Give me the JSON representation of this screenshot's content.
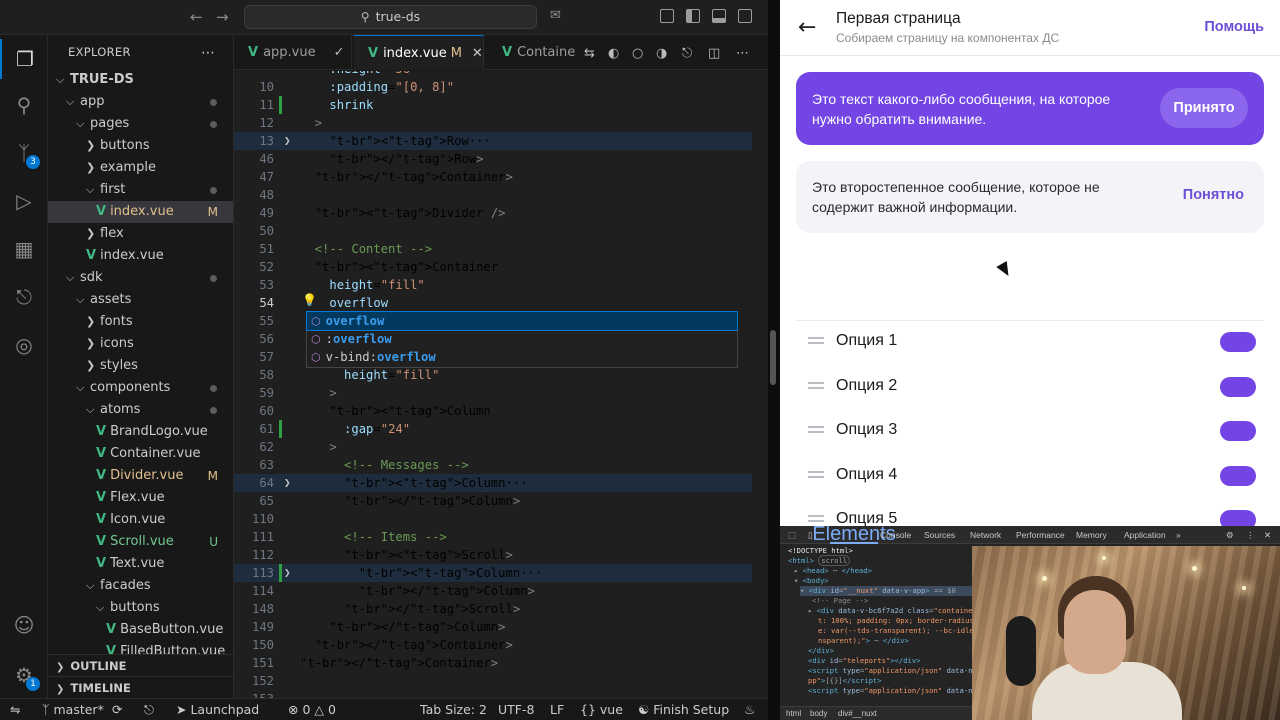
{
  "titlebar": {
    "search": "true-ds"
  },
  "activity": {
    "source_control_badge": "3",
    "accounts_badge": "1"
  },
  "sidebar": {
    "header": "EXPLORER",
    "tree": [
      {
        "label": "TRUE-DS",
        "depth": 0,
        "kind": "root"
      },
      {
        "label": "app",
        "depth": 1,
        "kind": "folder",
        "dot": true
      },
      {
        "label": "pages",
        "depth": 2,
        "kind": "folder",
        "dot": true
      },
      {
        "label": "buttons",
        "depth": 3,
        "kind": "folder-closed"
      },
      {
        "label": "example",
        "depth": 3,
        "kind": "folder-closed"
      },
      {
        "label": "first",
        "depth": 3,
        "kind": "folder",
        "dot": true
      },
      {
        "label": "index.vue",
        "depth": 4,
        "kind": "vue",
        "status": "M",
        "selected": true
      },
      {
        "label": "flex",
        "depth": 3,
        "kind": "folder-closed"
      },
      {
        "label": "index.vue",
        "depth": 3,
        "kind": "vue"
      },
      {
        "label": "sdk",
        "depth": 1,
        "kind": "folder",
        "dot": true
      },
      {
        "label": "assets",
        "depth": 2,
        "kind": "folder"
      },
      {
        "label": "fonts",
        "depth": 3,
        "kind": "folder-closed"
      },
      {
        "label": "icons",
        "depth": 3,
        "kind": "folder-closed"
      },
      {
        "label": "styles",
        "depth": 3,
        "kind": "folder-closed"
      },
      {
        "label": "components",
        "depth": 2,
        "kind": "folder",
        "dot": true,
        "modified": true
      },
      {
        "label": "atoms",
        "depth": 3,
        "kind": "folder",
        "dot": true,
        "modified": true
      },
      {
        "label": "BrandLogo.vue",
        "depth": 4,
        "kind": "vue"
      },
      {
        "label": "Container.vue",
        "depth": 4,
        "kind": "vue"
      },
      {
        "label": "Divider.vue",
        "depth": 4,
        "kind": "vue",
        "status": "M"
      },
      {
        "label": "Flex.vue",
        "depth": 4,
        "kind": "vue"
      },
      {
        "label": "Icon.vue",
        "depth": 4,
        "kind": "vue"
      },
      {
        "label": "Scroll.vue",
        "depth": 4,
        "kind": "vue",
        "status": "U"
      },
      {
        "label": "Text.vue",
        "depth": 4,
        "kind": "vue"
      },
      {
        "label": "facades",
        "depth": 3,
        "kind": "folder"
      },
      {
        "label": "buttons",
        "depth": 4,
        "kind": "folder"
      },
      {
        "label": "BaseButton.vue",
        "depth": 5,
        "kind": "vue"
      },
      {
        "label": "FilledButton.vue",
        "depth": 5,
        "kind": "vue"
      }
    ],
    "outline": "OUTLINE",
    "timeline": "TIMELINE"
  },
  "tabs": [
    {
      "label": "app.vue",
      "active": false
    },
    {
      "label": "index.vue",
      "active": true,
      "status": "M"
    },
    {
      "label": "Containe",
      "active": false
    }
  ],
  "editor": {
    "lines": [
      {
        "n": "",
        "code": "    :height=\"56\""
      },
      {
        "n": "10",
        "code": "    :padding=\"[0, 8]\""
      },
      {
        "n": "11",
        "code": "    shrink"
      },
      {
        "n": "12",
        "code": "  >"
      },
      {
        "n": "13",
        "code": "    <Row···",
        "fold": true,
        "hl": true
      },
      {
        "n": "46",
        "code": "    </Row>"
      },
      {
        "n": "47",
        "code": "  </Container>"
      },
      {
        "n": "48",
        "code": ""
      },
      {
        "n": "49",
        "code": "  <Divider />"
      },
      {
        "n": "50",
        "code": ""
      },
      {
        "n": "51",
        "code": "  <!-- Content -->"
      },
      {
        "n": "52",
        "code": "  <Container"
      },
      {
        "n": "53",
        "code": "    height=\"fill\""
      },
      {
        "n": "54",
        "code": "    overflow",
        "current": true
      },
      {
        "n": "55",
        "code": ""
      },
      {
        "n": "56",
        "code": ""
      },
      {
        "n": "57",
        "code": "      :padding=\"16\""
      },
      {
        "n": "58",
        "code": "      height=\"fill\""
      },
      {
        "n": "59",
        "code": "    >"
      },
      {
        "n": "60",
        "code": "    <Column"
      },
      {
        "n": "61",
        "code": "      :gap=\"24\""
      },
      {
        "n": "62",
        "code": "    >"
      },
      {
        "n": "63",
        "code": "      <!-- Messages -->"
      },
      {
        "n": "64",
        "code": "      <Column···",
        "fold": true,
        "hl": true
      },
      {
        "n": "65",
        "code": "      </Column>"
      },
      {
        "n": "110",
        "code": ""
      },
      {
        "n": "111",
        "code": "      <!-- Items -->"
      },
      {
        "n": "112",
        "code": "      <Scroll>"
      },
      {
        "n": "113",
        "code": "        <Column···",
        "fold": true,
        "hl": true
      },
      {
        "n": "114",
        "code": "        </Column>"
      },
      {
        "n": "148",
        "code": "      </Scroll>"
      },
      {
        "n": "149",
        "code": "    </Column>"
      },
      {
        "n": "150",
        "code": "  </Container>"
      },
      {
        "n": "151",
        "code": "</Container>"
      },
      {
        "n": "152",
        "code": ""
      },
      {
        "n": "153",
        "code": ""
      }
    ],
    "autocomplete": [
      {
        "pre": "",
        "match": "overflow",
        "post": ""
      },
      {
        "pre": ":",
        "match": "overflow",
        "post": ""
      },
      {
        "pre": "v-bind:",
        "match": "overflow",
        "post": ""
      }
    ]
  },
  "status": {
    "branch": "master*",
    "launchpad": "Launchpad",
    "errors": "0",
    "warnings": "0",
    "tab_size": "Tab Size: 2",
    "encoding": "UTF-8",
    "eol": "LF",
    "language": "vue",
    "finish_setup": "Finish Setup"
  },
  "app": {
    "title": "Первая страница",
    "subtitle": "Собираем страницу на компонентах ДС",
    "help": "Помощь",
    "message_primary": {
      "text": "Это текст какого-либо сообщения, на которое нужно обратить внимание.",
      "action": "Принято"
    },
    "message_secondary": {
      "text": "Это второстепенное сообщение, которое не содержит важной информации.",
      "action": "Понятно"
    },
    "options": [
      {
        "label": "Опция 1",
        "on": true
      },
      {
        "label": "Опция 2",
        "on": true
      },
      {
        "label": "Опция 3",
        "on": true
      },
      {
        "label": "Опция 4",
        "on": true
      },
      {
        "label": "Опция 5",
        "on": true
      }
    ],
    "accent": "#7245e4"
  },
  "devtools": {
    "tabs": [
      "Elements",
      "Console",
      "Sources",
      "Network",
      "Performance",
      "Memory",
      "Application"
    ],
    "active_tab": "Elements",
    "breadcrumb": [
      "html",
      "body",
      "div#__nuxt"
    ]
  }
}
